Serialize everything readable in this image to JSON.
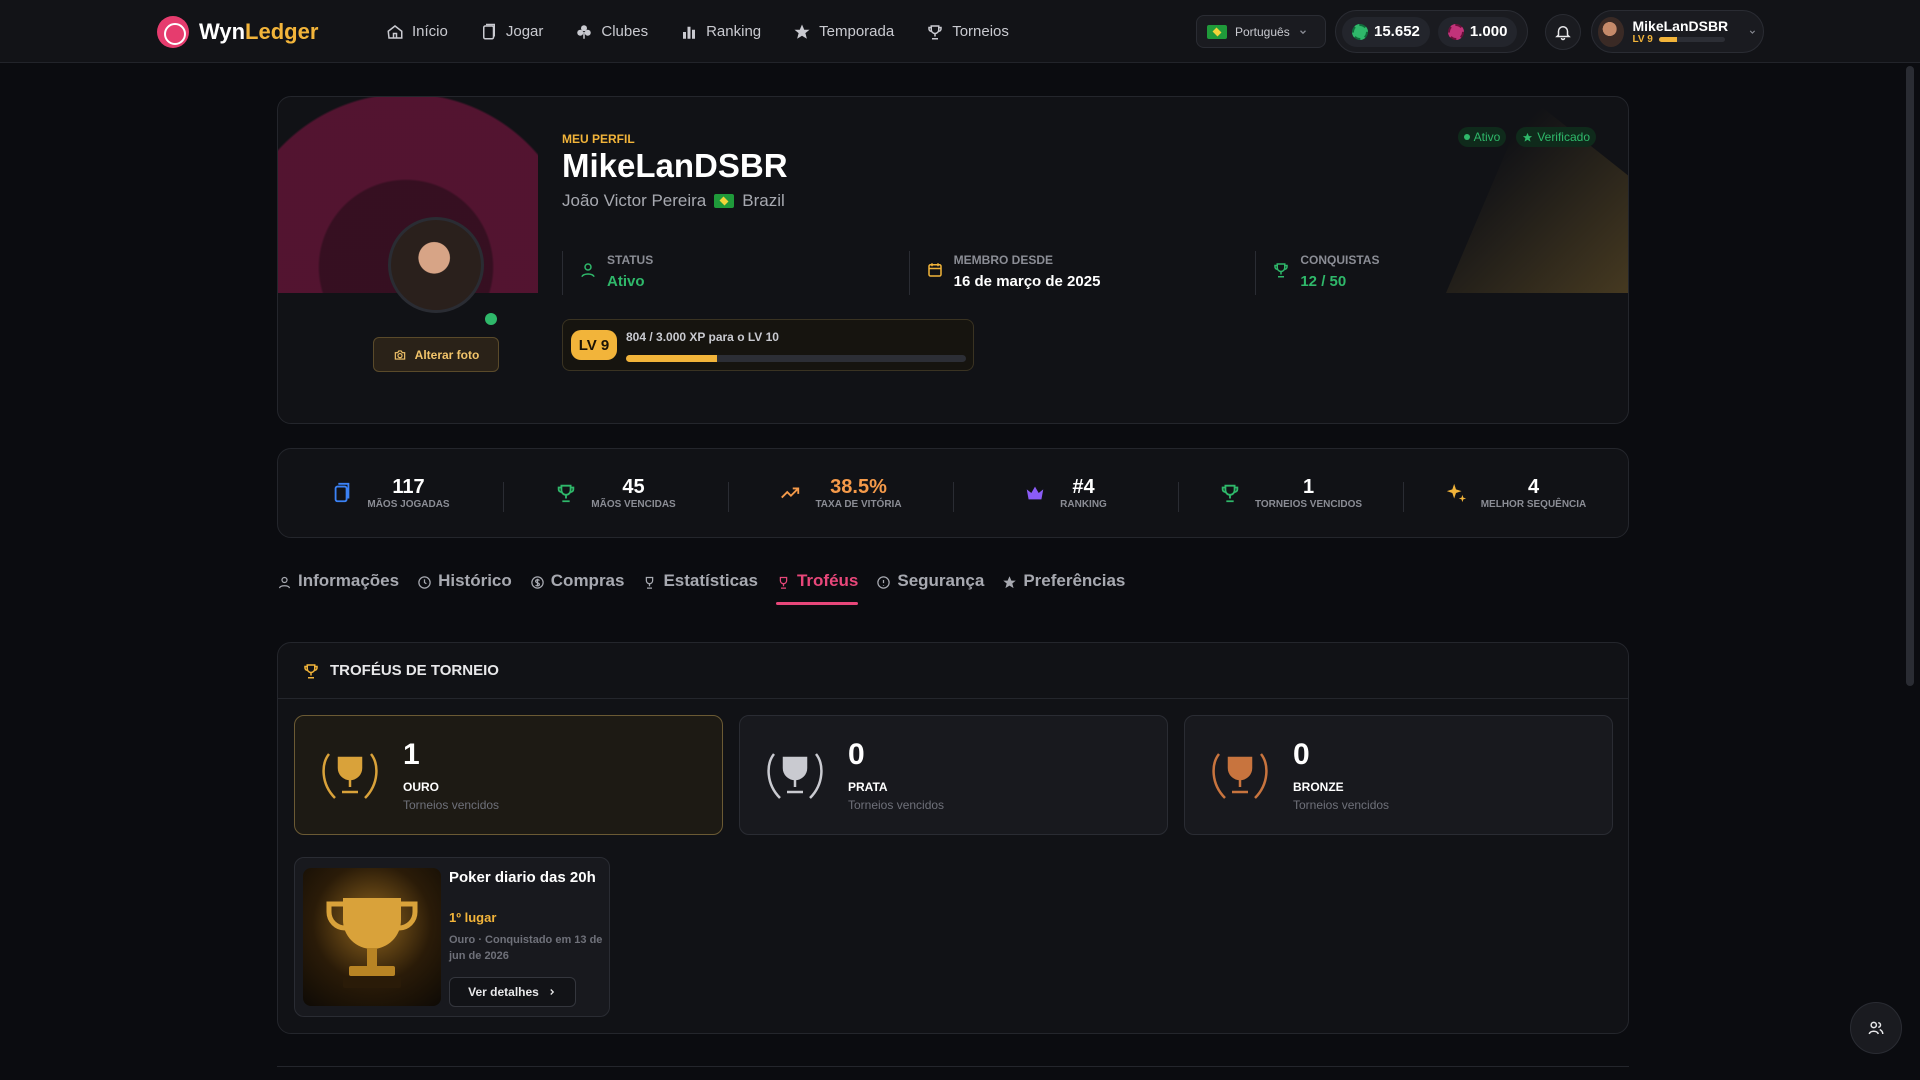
{
  "brand": {
    "name_prefix": "Wyn",
    "name_suffix": "Ledger"
  },
  "nav": [
    {
      "label": "Início",
      "icon": "home-icon"
    },
    {
      "label": "Jogar",
      "icon": "cards-icon"
    },
    {
      "label": "Clubes",
      "icon": "club-icon"
    },
    {
      "label": "Ranking",
      "icon": "bar-chart-icon"
    },
    {
      "label": "Temporada",
      "icon": "star-icon"
    },
    {
      "label": "Torneios",
      "icon": "trophy-icon"
    }
  ],
  "language": {
    "selected": "Português"
  },
  "wallet": {
    "chips": "15.652",
    "gems": "1.000"
  },
  "user": {
    "name": "MikeLanDSBR",
    "level": "LV 9",
    "xp_fraction": 0.268
  },
  "profile": {
    "eyebrow": "MEU PERFIL",
    "username": "MikeLanDSBR",
    "full_name": "João Victor Pereira",
    "country": "Brazil",
    "badges": {
      "active": "Ativo",
      "verified": "Verificado"
    },
    "alter_photo": "Alterar foto",
    "stats": [
      {
        "label": "STATUS",
        "value": "Ativo"
      },
      {
        "label": "MEMBRO DESDE",
        "value": "16 de março de 2025"
      },
      {
        "label": "CONQUISTAS",
        "value": "12 / 50"
      }
    ],
    "xp": {
      "level_chip": "LV 9",
      "text": "804 / 3.000 XP para o LV 10",
      "fraction": 0.268
    }
  },
  "summary": [
    {
      "value": "117",
      "label": "MÃOS JOGADAS",
      "icon": "cards-icon"
    },
    {
      "value": "45",
      "label": "MÃOS VENCIDAS",
      "icon": "trophy-icon"
    },
    {
      "value": "38.5%",
      "label": "TAXA DE VITÓRIA",
      "icon": "trend-up-icon"
    },
    {
      "value": "#4",
      "label": "RANKING",
      "icon": "crown-icon"
    },
    {
      "value": "1",
      "label": "TORNEIOS VENCIDOS",
      "icon": "trophy-icon"
    },
    {
      "value": "4",
      "label": "MELHOR SEQUÊNCIA",
      "icon": "sparkle-icon"
    }
  ],
  "tabs": [
    {
      "label": "Informações",
      "icon": "user-icon"
    },
    {
      "label": "Histórico",
      "icon": "clock-icon"
    },
    {
      "label": "Compras",
      "icon": "dollar-icon"
    },
    {
      "label": "Estatísticas",
      "icon": "trophy-icon"
    },
    {
      "label": "Troféus",
      "icon": "trophy-icon"
    },
    {
      "label": "Segurança",
      "icon": "info-icon"
    },
    {
      "label": "Preferências",
      "icon": "star-icon"
    }
  ],
  "active_tab": "Troféus",
  "trophies": {
    "title": "TROFÉUS DE TORNEIO",
    "cards": [
      {
        "count": "1",
        "name": "OURO",
        "sub": "Torneios vencidos",
        "color": "#d9a23a"
      },
      {
        "count": "0",
        "name": "PRATA",
        "sub": "Torneios vencidos",
        "color": "#c9cad0"
      },
      {
        "count": "0",
        "name": "BRONZE",
        "sub": "Torneios vencidos",
        "color": "#c8743e"
      }
    ],
    "event": {
      "title": "Poker diario das 20h",
      "place": "1º lugar",
      "desc": "Ouro · Conquistado em 13 de jun de 2026",
      "button": "Ver detalhes"
    }
  },
  "colors": {
    "accent_pink": "#e8477a",
    "gold": "#f2b43a",
    "green": "#2fb86a",
    "bg": "#0b0c10"
  }
}
